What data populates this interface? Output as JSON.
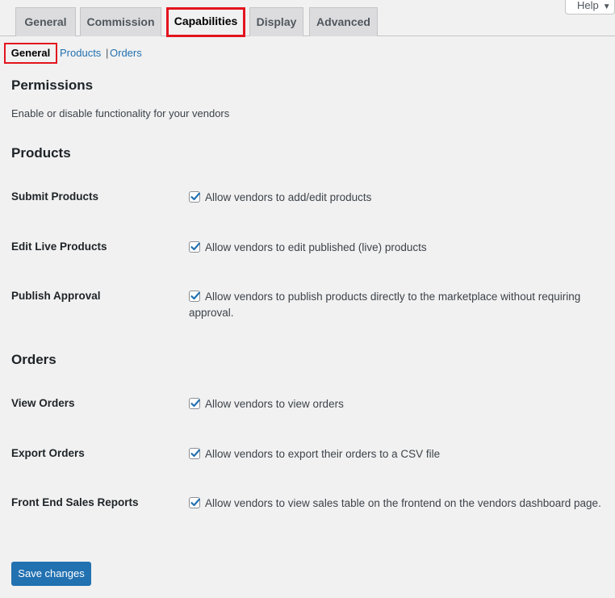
{
  "help": {
    "label": "Help"
  },
  "tabs": [
    {
      "label": "General"
    },
    {
      "label": "Commission"
    },
    {
      "label": "Capabilities"
    },
    {
      "label": "Display"
    },
    {
      "label": "Advanced"
    }
  ],
  "active_tab": "Capabilities",
  "subnav": {
    "current": "General",
    "products": "Products",
    "separator": "|",
    "orders": "Orders"
  },
  "permissions": {
    "title": "Permissions",
    "description": "Enable or disable functionality for your vendors"
  },
  "products_section": {
    "title": "Products",
    "rows": [
      {
        "label": "Submit Products",
        "field": "Allow vendors to add/edit products",
        "checked": true
      },
      {
        "label": "Edit Live Products",
        "field": "Allow vendors to edit published (live) products",
        "checked": true
      },
      {
        "label": "Publish Approval",
        "field": "Allow vendors to publish products directly to the marketplace without requiring approval.",
        "checked": true
      }
    ]
  },
  "orders_section": {
    "title": "Orders",
    "rows": [
      {
        "label": "View Orders",
        "field": "Allow vendors to view orders",
        "checked": true
      },
      {
        "label": "Export Orders",
        "field": "Allow vendors to export their orders to a CSV file",
        "checked": true
      },
      {
        "label": "Front End Sales Reports",
        "field": "Allow vendors to view sales table on the frontend on the vendors dashboard page.",
        "checked": true
      }
    ]
  },
  "save_button": {
    "label": "Save changes"
  },
  "colors": {
    "accent": "#2271b1",
    "highlight": "#e3141e",
    "background": "#f1f1f1"
  }
}
